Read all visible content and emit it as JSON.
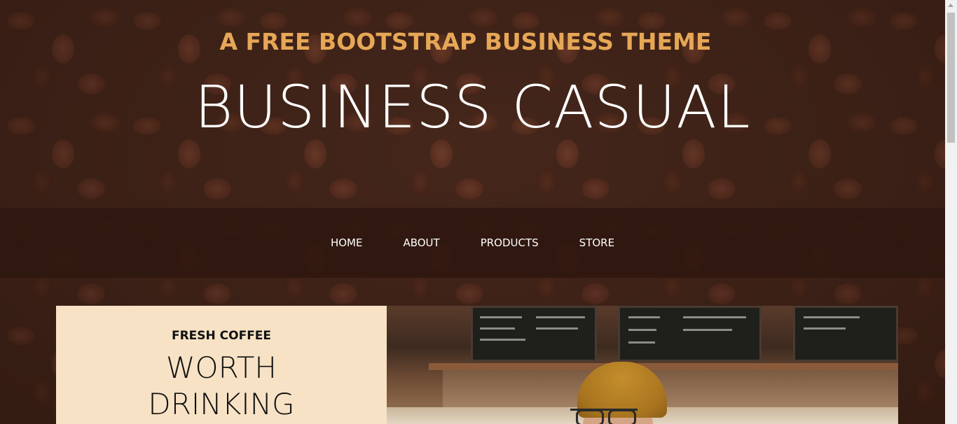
{
  "header": {
    "upper": "A FREE BOOTSTRAP BUSINESS THEME",
    "lower": "BUSINESS CASUAL"
  },
  "nav": {
    "items": [
      {
        "label": "HOME"
      },
      {
        "label": "ABOUT"
      },
      {
        "label": "PRODUCTS"
      },
      {
        "label": "STORE"
      }
    ]
  },
  "intro": {
    "upper": "FRESH COFFEE",
    "lower_line1": "WORTH",
    "lower_line2": "DRINKING"
  },
  "colors": {
    "accent": "#e6a756",
    "nav_bg": "#2f170f",
    "intro_bg": "#f7e2c5"
  },
  "images": {
    "background": "coffee-beans",
    "intro": "barista-in-cafe"
  }
}
